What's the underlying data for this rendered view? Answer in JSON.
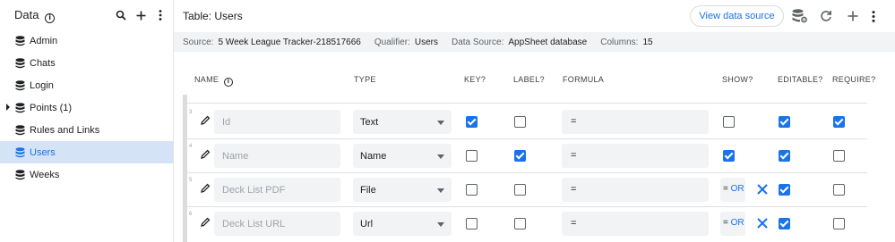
{
  "sidebar": {
    "title": "Data",
    "items": [
      {
        "label": "Admin"
      },
      {
        "label": "Chats"
      },
      {
        "label": "Login"
      },
      {
        "label": "Points (1)"
      },
      {
        "label": "Rules and Links"
      },
      {
        "label": "Users"
      },
      {
        "label": "Weeks"
      }
    ]
  },
  "header": {
    "title": "Table: Users",
    "view_data_source": "View data source"
  },
  "info": {
    "source_label": "Source:",
    "source": "5 Week League Tracker-218517666",
    "qualifier_label": "Qualifier:",
    "qualifier": "Users",
    "datasource_label": "Data Source:",
    "datasource": "AppSheet database",
    "columns_label": "Columns:",
    "columns": "15"
  },
  "columns": {
    "name": "NAME",
    "type": "TYPE",
    "key": "KEY?",
    "label": "LABEL?",
    "formula": "FORMULA",
    "show": "SHOW?",
    "editable": "EDITABLE?",
    "require": "REQUIRE?"
  },
  "rows": [
    {
      "num": "3",
      "name": "Id",
      "type": "Text",
      "key": true,
      "label": false,
      "formula": "=",
      "show_formula": "",
      "show": false,
      "editable": true,
      "require": true
    },
    {
      "num": "4",
      "name": "Name",
      "type": "Name",
      "key": false,
      "label": true,
      "formula": "=",
      "show_formula": "",
      "show": true,
      "editable": true,
      "require": false
    },
    {
      "num": "5",
      "name": "Deck List PDF",
      "type": "File",
      "key": false,
      "label": false,
      "formula": "=",
      "show_formula": "OR",
      "show": false,
      "editable": true,
      "require": false
    },
    {
      "num": "6",
      "name": "Deck List URL",
      "type": "Url",
      "key": false,
      "label": false,
      "formula": "=",
      "show_formula": "OR",
      "show": false,
      "editable": true,
      "require": false
    }
  ],
  "colors": {
    "accent": "#1a73e8",
    "active_bg": "#d5e3f6"
  }
}
